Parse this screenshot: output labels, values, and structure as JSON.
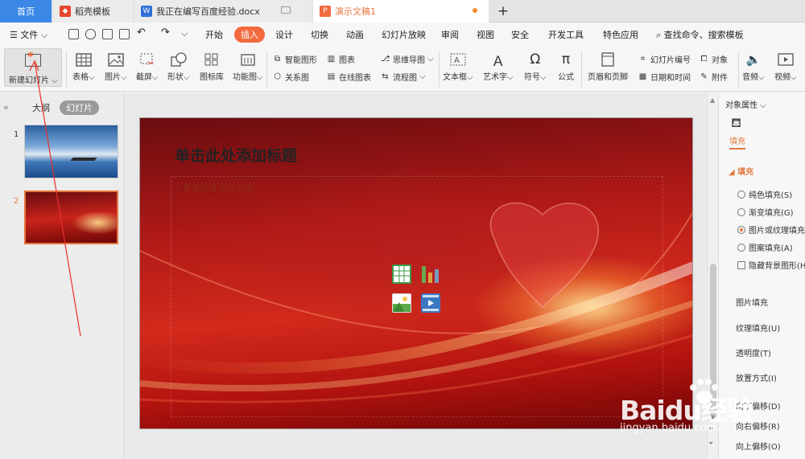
{
  "tabs": [
    {
      "label": "首页"
    },
    {
      "label": "稻壳模板"
    },
    {
      "label": "我正在编写百度经验.docx"
    },
    {
      "label": "演示文稿1"
    }
  ],
  "menubar": {
    "file": "文件",
    "items": [
      "开始",
      "插入",
      "设计",
      "切换",
      "动画",
      "幻灯片放映",
      "审阅",
      "视图",
      "安全",
      "开发工具",
      "特色应用"
    ],
    "active": "插入",
    "search": "查找命令、搜索模板"
  },
  "ribbon": {
    "new_slide": "新建幻灯片",
    "table": "表格",
    "picture": "图片",
    "screenshot": "截屏",
    "shape": "形状",
    "gallery": "图标库",
    "function_chart": "功能图",
    "smart_shape": "智能图形",
    "chart": "图表",
    "relation": "关系图",
    "online_chart": "在线图表",
    "mindmap": "思维导图",
    "flowchart": "流程图",
    "textbox": "文本框",
    "art_text": "艺术字",
    "symbol": "符号",
    "formula": "公式",
    "header_footer": "页眉和页脚",
    "slide_number": "幻灯片编号",
    "object": "对象",
    "datetime": "日期和时间",
    "attachment": "附件",
    "audio": "音频",
    "video": "视频"
  },
  "leftpanel": {
    "outline": "大纲",
    "slides": "幻灯片",
    "numbers": [
      "1",
      "2"
    ]
  },
  "slide": {
    "title": "单击此处添加标题",
    "body": "单击此处添加文本"
  },
  "rightpanel": {
    "title": "对象属性",
    "fill_tab": "填充",
    "section": "填充",
    "options": [
      "纯色填充(S)",
      "渐变填充(G)",
      "图片或纹理填充",
      "图案填充(A)"
    ],
    "hide_bg": "隐藏背景图形(H)",
    "props": [
      "图片填充",
      "纹理填充(U)",
      "透明度(T)",
      "放置方式(I)",
      "向下偏移(D)",
      "向右偏移(R)",
      "向上偏移(O)"
    ]
  },
  "watermark": {
    "main": "Baidu经验",
    "sub": "jingyan.baidu.com"
  },
  "colors": {
    "accent": "#e5773f",
    "home_tab": "#3a87e6",
    "active_menu": "#f26a3d"
  }
}
